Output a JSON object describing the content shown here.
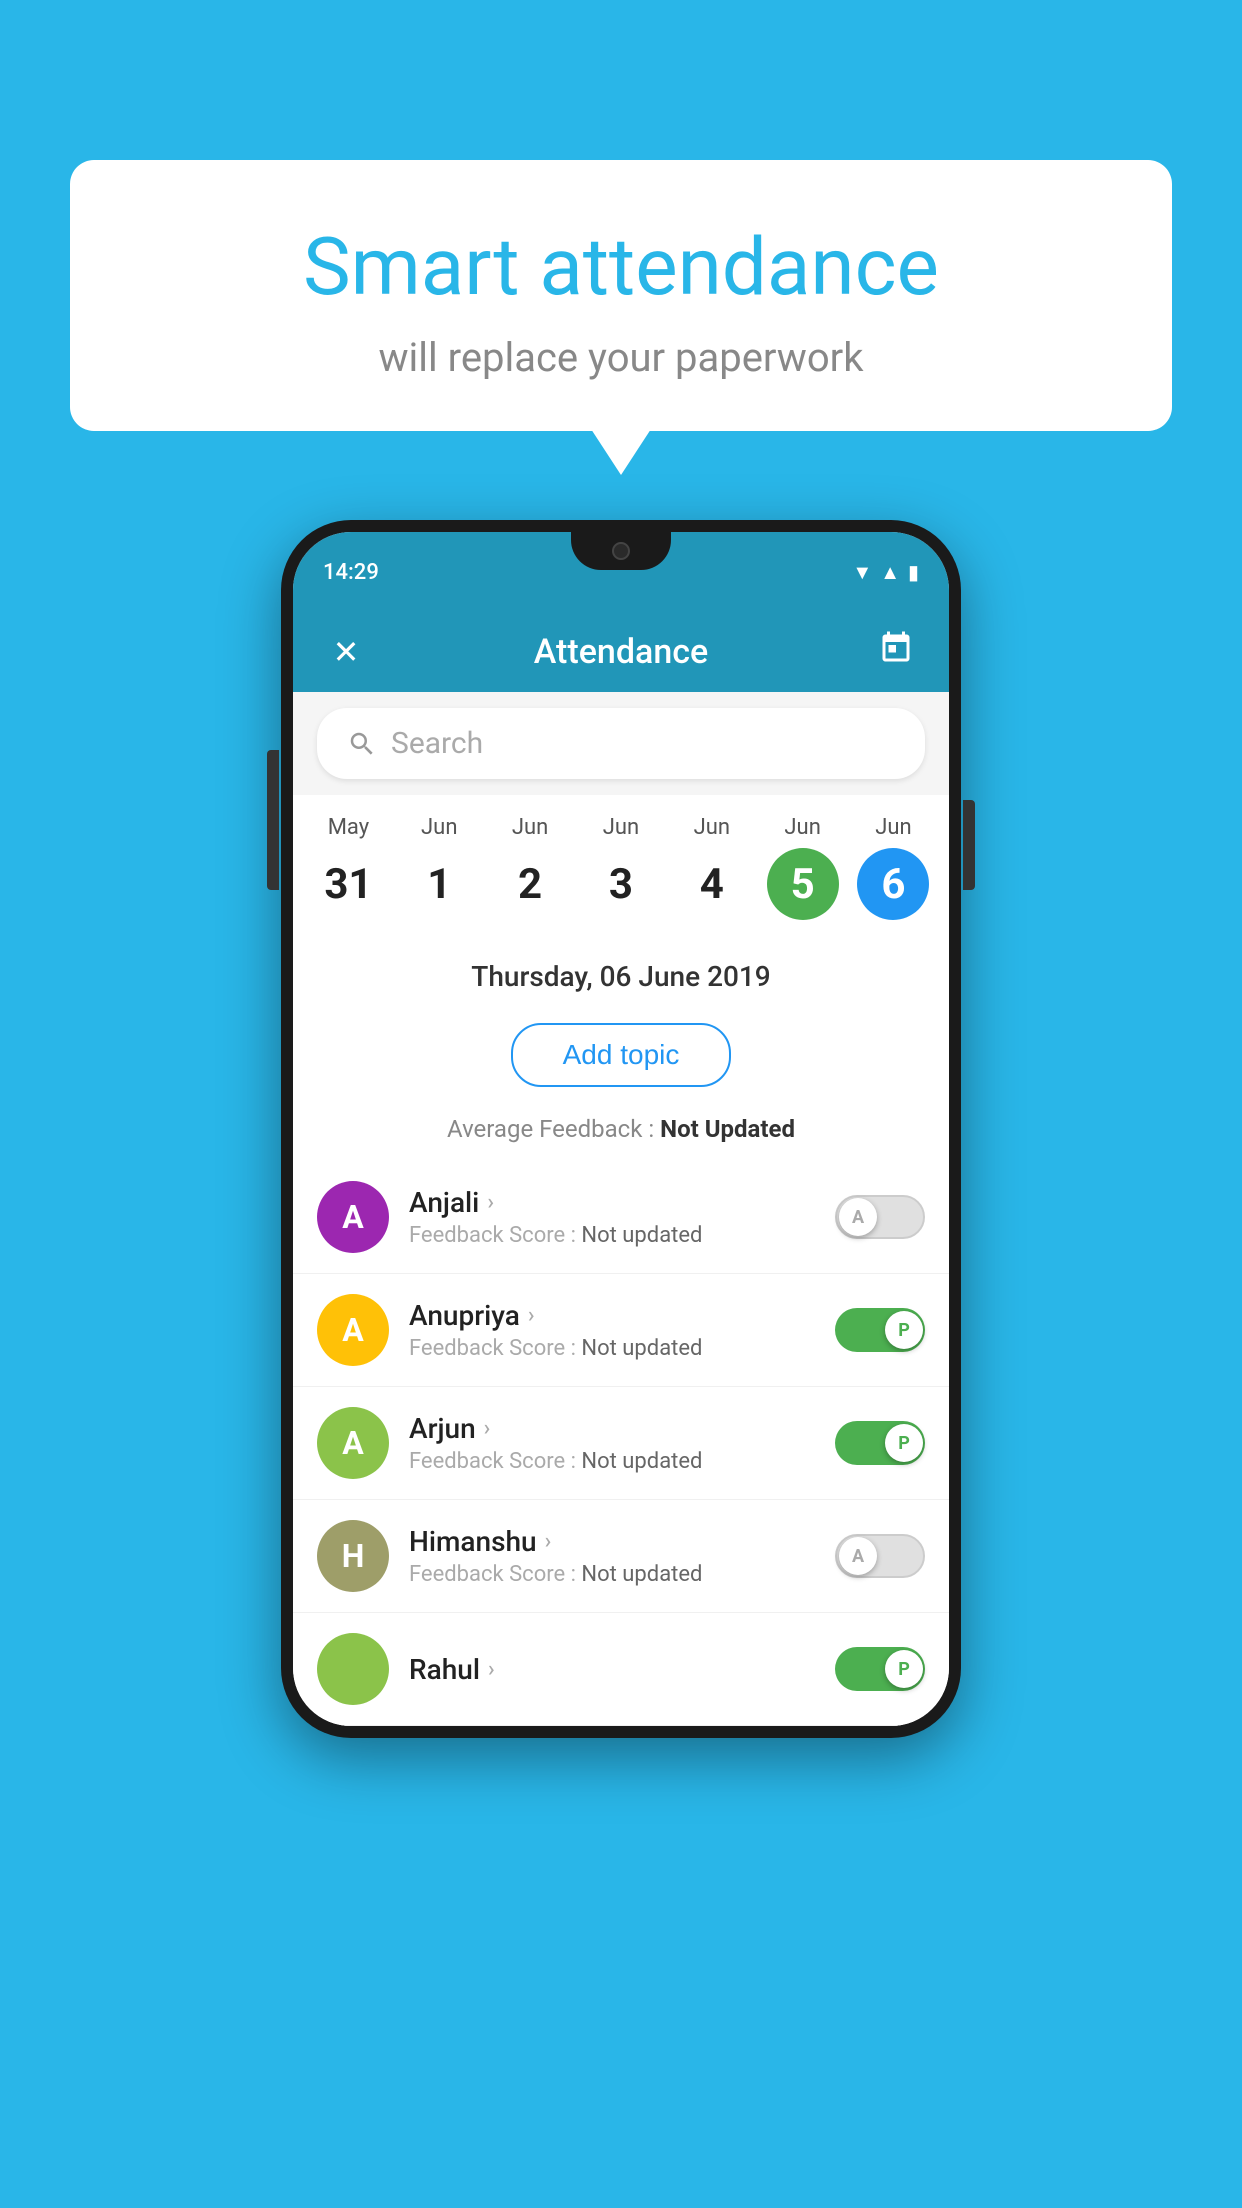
{
  "background_color": "#29B6E8",
  "speech_bubble": {
    "title": "Smart attendance",
    "subtitle": "will replace your paperwork"
  },
  "status_bar": {
    "time": "14:29",
    "icons": [
      "wifi",
      "signal",
      "battery"
    ]
  },
  "app_bar": {
    "title": "Attendance",
    "close_icon": "✕",
    "calendar_icon": "📅"
  },
  "search": {
    "placeholder": "Search"
  },
  "calendar": {
    "days": [
      {
        "month": "May",
        "date": "31",
        "state": "normal"
      },
      {
        "month": "Jun",
        "date": "1",
        "state": "normal"
      },
      {
        "month": "Jun",
        "date": "2",
        "state": "normal"
      },
      {
        "month": "Jun",
        "date": "3",
        "state": "normal"
      },
      {
        "month": "Jun",
        "date": "4",
        "state": "normal"
      },
      {
        "month": "Jun",
        "date": "5",
        "state": "today"
      },
      {
        "month": "Jun",
        "date": "6",
        "state": "selected"
      }
    ]
  },
  "selected_date": "Thursday, 06 June 2019",
  "add_topic_label": "Add topic",
  "average_feedback_label": "Average Feedback : ",
  "average_feedback_value": "Not Updated",
  "students": [
    {
      "name": "Anjali",
      "initial": "A",
      "avatar_color": "purple",
      "feedback": "Feedback Score : ",
      "feedback_value": "Not updated",
      "attendance": "absent"
    },
    {
      "name": "Anupriya",
      "initial": "A",
      "avatar_color": "yellow",
      "feedback": "Feedback Score : ",
      "feedback_value": "Not updated",
      "attendance": "present"
    },
    {
      "name": "Arjun",
      "initial": "A",
      "avatar_color": "green",
      "feedback": "Feedback Score : ",
      "feedback_value": "Not updated",
      "attendance": "present"
    },
    {
      "name": "Himanshu",
      "initial": "H",
      "avatar_color": "olive",
      "feedback": "Feedback Score : ",
      "feedback_value": "Not updated",
      "attendance": "absent"
    }
  ]
}
